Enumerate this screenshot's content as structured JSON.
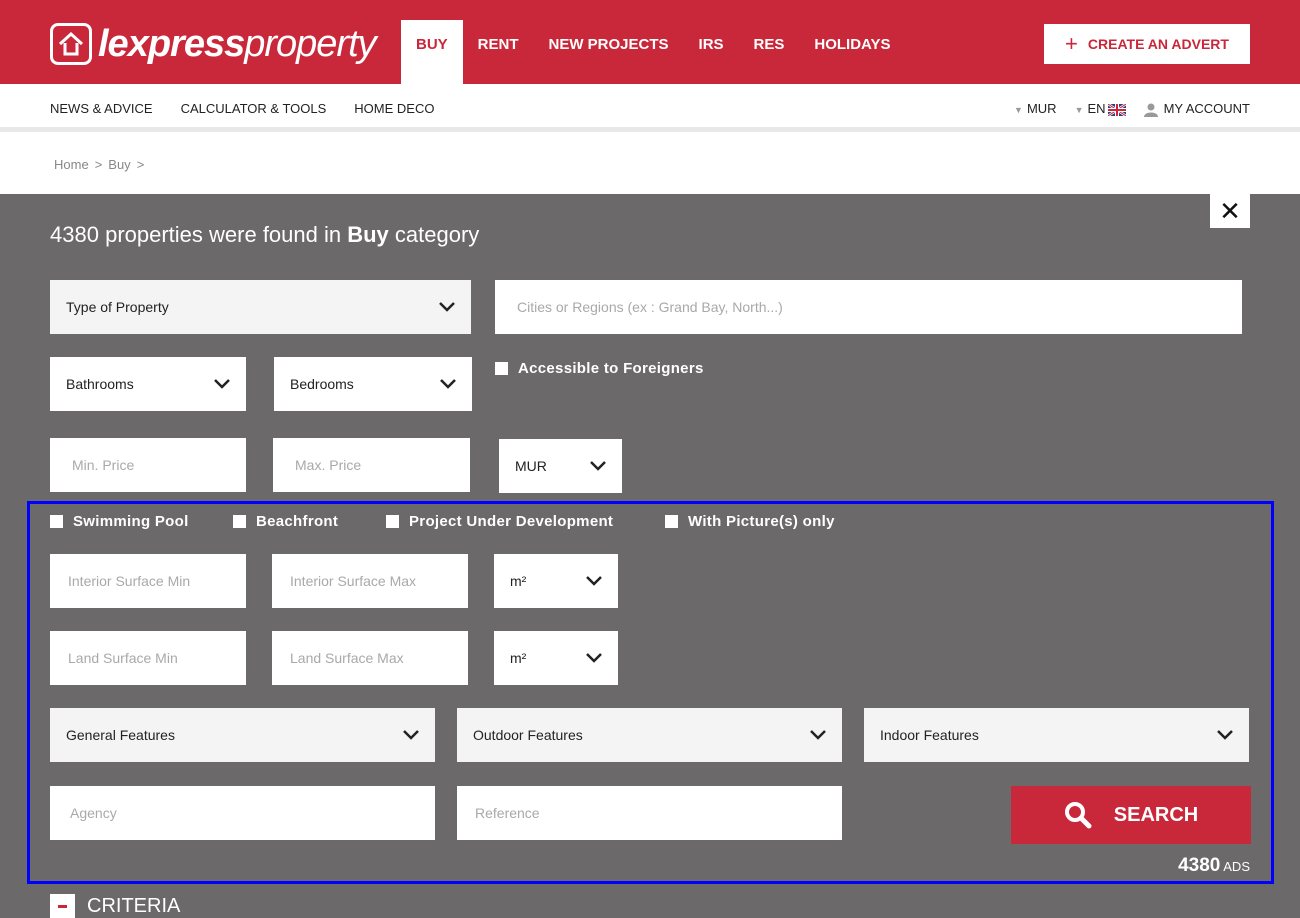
{
  "brand": {
    "logo_bold": "lexpress",
    "logo_light": "property"
  },
  "mainnav": [
    {
      "label": "BUY",
      "active": true
    },
    {
      "label": "RENT",
      "active": false
    },
    {
      "label": "NEW PROJECTS",
      "active": false
    },
    {
      "label": "IRS",
      "active": false
    },
    {
      "label": "RES",
      "active": false
    },
    {
      "label": "HOLIDAYS",
      "active": false
    }
  ],
  "create_advert": {
    "icon": "plus-icon",
    "label": "CREATE AN ADVERT"
  },
  "subnav": {
    "links": [
      "NEWS & ADVICE",
      "CALCULATOR & TOOLS",
      "HOME DECO"
    ],
    "currency": "MUR",
    "language": "EN",
    "account": "MY ACCOUNT"
  },
  "breadcrumb": [
    "Home",
    ">",
    "Buy",
    ">"
  ],
  "results": {
    "count": "4380",
    "text_mid": "properties were found in",
    "category": "Buy",
    "text_end": "category"
  },
  "form": {
    "type_of_property": "Type of Property",
    "cities_placeholder": "Cities or Regions (ex : Grand Bay, North...)",
    "bathrooms": "Bathrooms",
    "bedrooms": "Bedrooms",
    "accessible_foreigners": "Accessible to Foreigners",
    "min_price_placeholder": "Min. Price",
    "max_price_placeholder": "Max. Price",
    "price_currency": "MUR",
    "checks": [
      "Swimming Pool",
      "Beachfront",
      "Project Under Development",
      "With Picture(s) only"
    ],
    "interior_min_placeholder": "Interior Surface Min",
    "interior_max_placeholder": "Interior Surface Max",
    "interior_unit": "m²",
    "land_min_placeholder": "Land Surface Min",
    "land_max_placeholder": "Land Surface Max",
    "land_unit": "m²",
    "general_features": "General Features",
    "outdoor_features": "Outdoor Features",
    "indoor_features": "Indoor Features",
    "agency_placeholder": "Agency",
    "reference_placeholder": "Reference",
    "search_label": "SEARCH"
  },
  "ads": {
    "count": "4380",
    "label": "ADS"
  },
  "criteria_label": "CRITERIA",
  "colors": {
    "brand_red": "#c9283a",
    "panel_grey": "#6b696a",
    "highlight": "#0000ff"
  }
}
